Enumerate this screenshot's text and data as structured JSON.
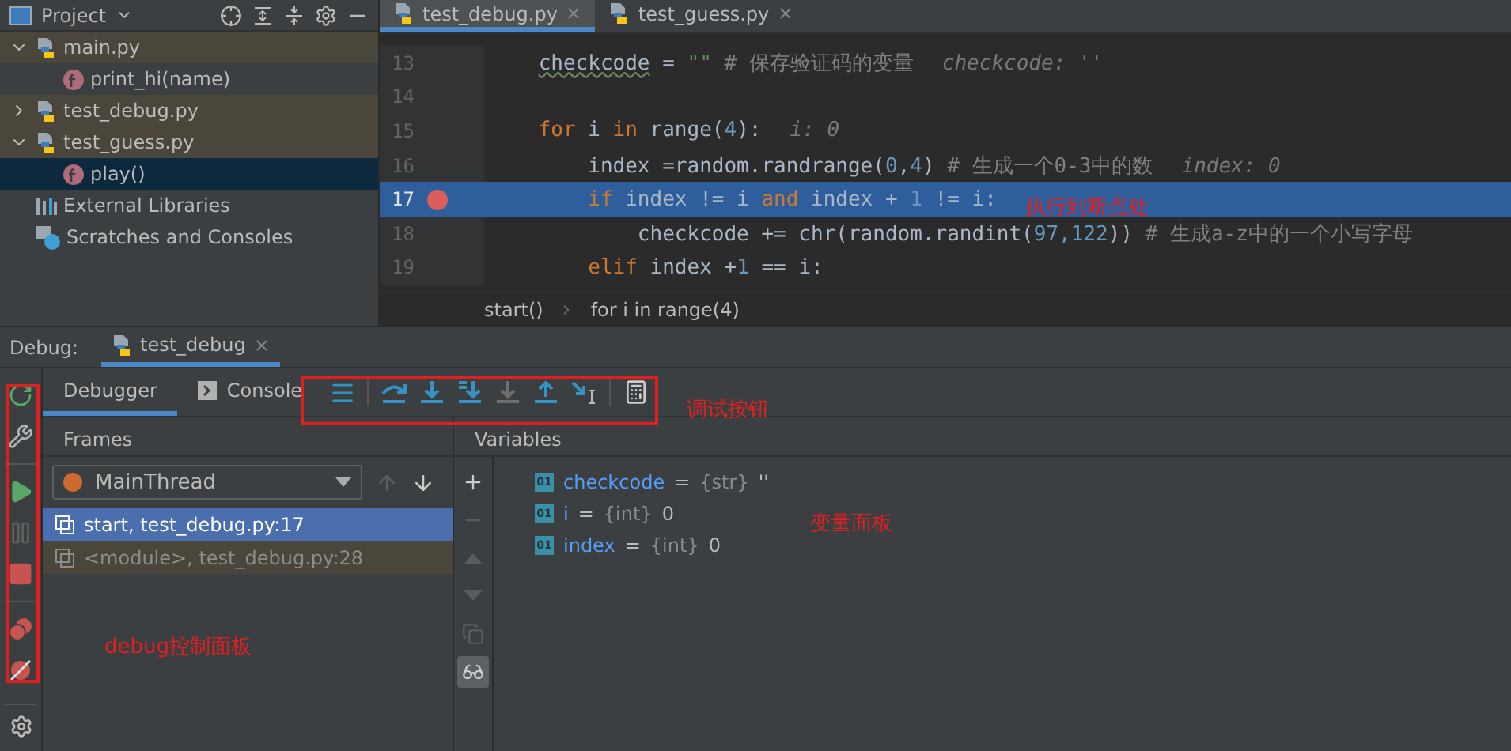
{
  "project": {
    "title": "Project",
    "tree": [
      {
        "label": "main.py",
        "kind": "file",
        "expanded": true,
        "selected": false,
        "children": [
          {
            "label": "print_hi(name)",
            "kind": "function",
            "selected": false
          }
        ]
      },
      {
        "label": "test_debug.py",
        "kind": "file",
        "expanded": false,
        "selected": false
      },
      {
        "label": "test_guess.py",
        "kind": "file",
        "expanded": true,
        "selected": false,
        "children": [
          {
            "label": "play()",
            "kind": "function",
            "selected": true
          }
        ]
      },
      {
        "label": "External Libraries",
        "kind": "library",
        "selected": false
      },
      {
        "label": "Scratches and Consoles",
        "kind": "scratch",
        "selected": false
      }
    ]
  },
  "editor": {
    "tabs": [
      {
        "label": "test_debug.py",
        "selected": true
      },
      {
        "label": "test_guess.py",
        "selected": false
      }
    ],
    "lines": [
      {
        "number": "13",
        "breakpoint": false,
        "current": false,
        "tokens": [
          {
            "kind": "warn",
            "text": "    checkcode"
          },
          {
            "kind": "plain",
            "text": " = "
          },
          {
            "kind": "string",
            "text": "\"\""
          },
          {
            "kind": "comment",
            "text": " # 保存验证码的变量"
          },
          {
            "kind": "hint",
            "text": "checkcode: ''"
          }
        ]
      },
      {
        "number": "14",
        "breakpoint": false,
        "current": false
      },
      {
        "number": "15",
        "breakpoint": false,
        "current": false,
        "tokens": [
          {
            "kind": "keyword",
            "text": "    for"
          },
          {
            "kind": "plain",
            "text": " i "
          },
          {
            "kind": "keyword",
            "text": "in"
          },
          {
            "kind": "plain",
            "text": " range("
          },
          {
            "kind": "number",
            "text": "4"
          },
          {
            "kind": "plain",
            "text": "):"
          },
          {
            "kind": "hint",
            "text": "i: 0"
          }
        ]
      },
      {
        "number": "16",
        "breakpoint": false,
        "current": false,
        "tokens": [
          {
            "kind": "plain",
            "text": "        index =random.randrange("
          },
          {
            "kind": "number",
            "text": "0"
          },
          {
            "kind": "plain",
            "text": ","
          },
          {
            "kind": "number",
            "text": "4"
          },
          {
            "kind": "plain",
            "text": ")"
          },
          {
            "kind": "comment",
            "text": " # 生成一个0-3中的数"
          },
          {
            "kind": "hint",
            "text": "index: 0"
          }
        ]
      },
      {
        "number": "17",
        "breakpoint": true,
        "current": true,
        "tokens": [
          {
            "kind": "keyword",
            "text": "        if"
          },
          {
            "kind": "plain",
            "text": " index != i "
          },
          {
            "kind": "keyword",
            "text": "and"
          },
          {
            "kind": "plain",
            "text": " index + "
          },
          {
            "kind": "number",
            "text": "1"
          },
          {
            "kind": "plain",
            "text": " != i:"
          }
        ]
      },
      {
        "number": "18",
        "breakpoint": false,
        "current": false,
        "tokens": [
          {
            "kind": "plain",
            "text": "            checkcode += chr(random.randint("
          },
          {
            "kind": "number",
            "text": "97,122"
          },
          {
            "kind": "plain",
            "text": "))"
          },
          {
            "kind": "comment",
            "text": " # 生成a-z中的一个小写字母"
          }
        ]
      },
      {
        "number": "19",
        "breakpoint": false,
        "current": false,
        "tokens": [
          {
            "kind": "keyword",
            "text": "        elif"
          },
          {
            "kind": "plain",
            "text": " index +"
          },
          {
            "kind": "number",
            "text": "1"
          },
          {
            "kind": "plain",
            "text": " == i:"
          }
        ]
      }
    ],
    "note": "执行到断点处",
    "breadcrumbs": [
      "start()",
      "for i in range(4)"
    ]
  },
  "debug": {
    "label": "Debug:",
    "tabs": [
      {
        "label": "test_debug",
        "selected": true
      }
    ],
    "side_tools": [
      {
        "kind": "rerun",
        "disabled": false
      },
      {
        "kind": "settings",
        "disabled": false
      },
      {
        "kind": "separator"
      },
      {
        "kind": "resume",
        "disabled": false
      },
      {
        "kind": "pause",
        "disabled": true
      },
      {
        "kind": "stop",
        "disabled": false
      },
      {
        "kind": "separator"
      },
      {
        "kind": "breakpoints",
        "disabled": false
      },
      {
        "kind": "mute",
        "disabled": false
      }
    ],
    "side_note": "debug控制面板",
    "subtabs": [
      {
        "label": "Debugger",
        "kind": "debugger",
        "selected": true
      },
      {
        "label": "Console",
        "kind": "console",
        "selected": false
      }
    ],
    "step_tools": [
      {
        "kind": "frames",
        "disabled": false
      },
      {
        "kind": "separator"
      },
      {
        "kind": "step_over",
        "disabled": false
      },
      {
        "kind": "step_into",
        "disabled": false
      },
      {
        "kind": "step_into_my",
        "disabled": false
      },
      {
        "kind": "force_step",
        "disabled": true
      },
      {
        "kind": "step_out",
        "disabled": false
      },
      {
        "kind": "run_to_cursor",
        "disabled": false
      },
      {
        "kind": "separator"
      },
      {
        "kind": "evaluate",
        "disabled": false
      }
    ],
    "toolbar_note": "调试按钮",
    "frames": {
      "title": "Frames",
      "thread": "MainThread",
      "up_disabled": true,
      "down_disabled": false,
      "items": [
        {
          "label": "start, test_debug.py:17",
          "selected": true,
          "dimmed": false
        },
        {
          "label": "<module>, test_debug.py:28",
          "selected": false,
          "dimmed": true
        }
      ]
    },
    "variables": {
      "title": "Variables",
      "tools": [
        {
          "kind": "add",
          "disabled": false,
          "selected": false
        },
        {
          "kind": "remove",
          "disabled": true,
          "selected": false
        },
        {
          "kind": "up",
          "disabled": true,
          "selected": false
        },
        {
          "kind": "down",
          "disabled": true,
          "selected": false
        },
        {
          "kind": "copy",
          "disabled": true,
          "selected": false
        },
        {
          "kind": "watches",
          "disabled": false,
          "selected": true
        }
      ],
      "items": [
        {
          "icon": "01",
          "name": "checkcode",
          "assign": "=",
          "type": "{str}",
          "value": "''"
        },
        {
          "icon": "01",
          "name": "i",
          "assign": "=",
          "type": "{int}",
          "value": "0"
        },
        {
          "icon": "01",
          "name": "index",
          "assign": "=",
          "type": "{int}",
          "value": "0"
        }
      ],
      "note": "变量面板"
    }
  }
}
